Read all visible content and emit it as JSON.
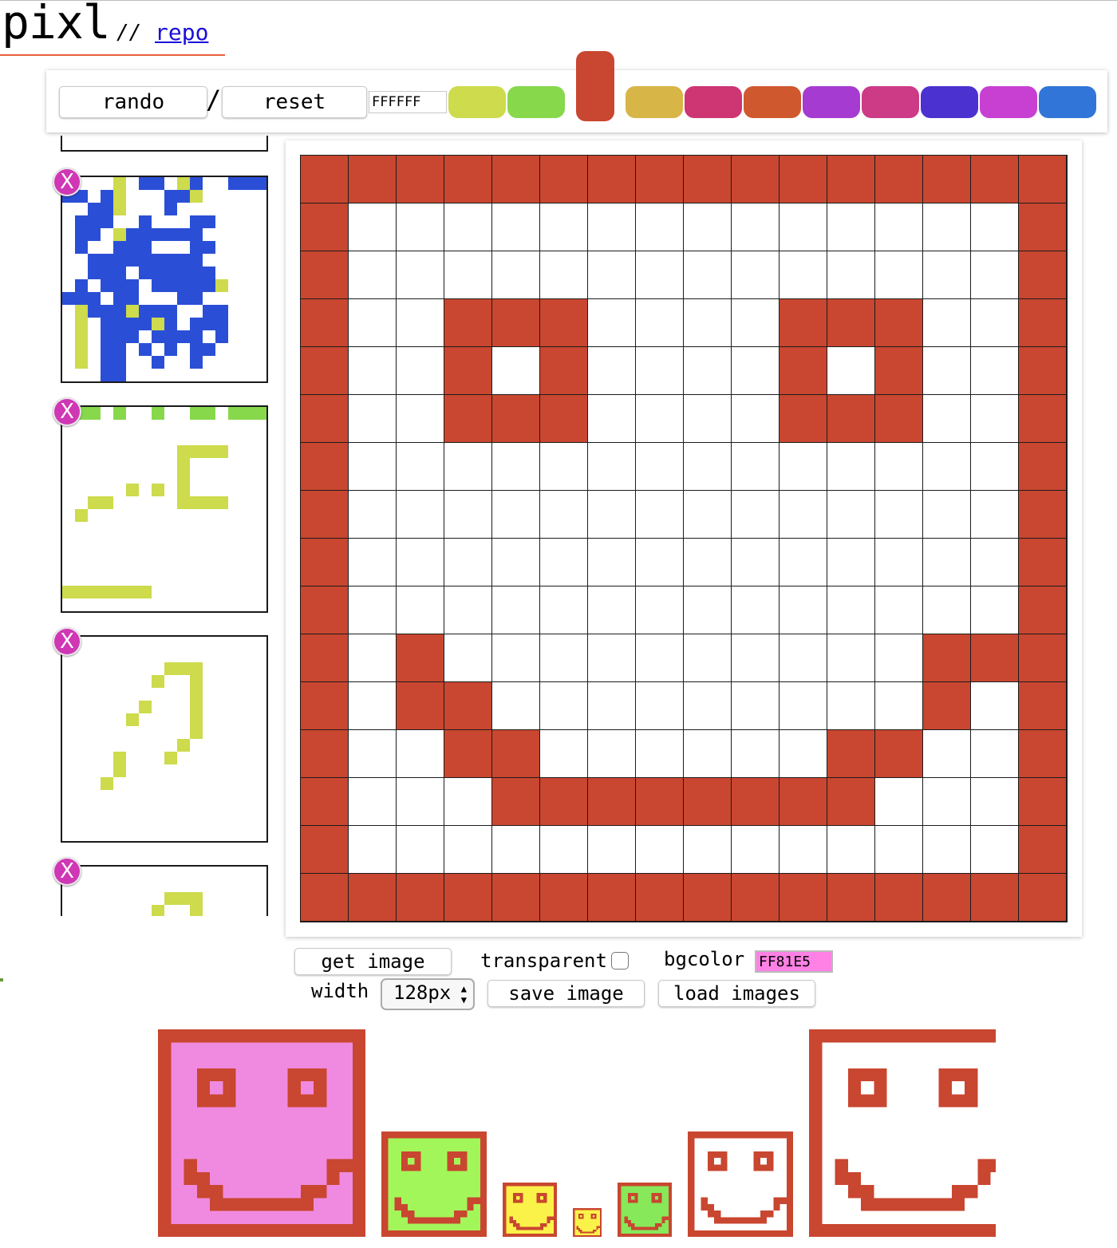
{
  "header": {
    "title": "pixl",
    "separator": "//",
    "repo_link": "repo"
  },
  "toolbar": {
    "rando_label": "rando",
    "slash": "/",
    "reset_label": "reset",
    "hex_value": "FFFFFF",
    "swatches": [
      "#cddb4c",
      "#87d84b",
      "#c94630",
      "#d8b547",
      "#cd3573",
      "#d0582f",
      "#a53bd0",
      "#cd3a86",
      "#4b31cf",
      "#c840d1",
      "#3275d8"
    ],
    "selected_swatch": 2
  },
  "thumbnails": {
    "delete_label": "X",
    "items": [
      {
        "colors": [
          "#2a4fd6",
          "#cddb4c"
        ]
      },
      {
        "colors": [
          "#cddb4c",
          "#87d84b"
        ]
      },
      {
        "colors": [
          "#cddb4c"
        ]
      },
      {
        "colors": [
          "#cddb4c"
        ]
      }
    ]
  },
  "editor": {
    "grid_size": 16,
    "paint_color": "#c94630",
    "background_color": "#ffffff",
    "rows": [
      "1111111111111111",
      "1000000000000001",
      "1000000000000001",
      "1001110000111001",
      "1001010000101001",
      "1001110000111001",
      "1000000000000001",
      "1000000000000001",
      "1000000000000001",
      "1000000000000001",
      "1010000000000111",
      "1011000000000101",
      "1001100000011001",
      "1000111111110001",
      "1000000000000001",
      "1111111111111111"
    ]
  },
  "controls": {
    "get_image_label": "get image",
    "transparent_label": "transparent",
    "transparent_checked": false,
    "bgcolor_label": "bgcolor",
    "bgcolor_value": "FF81E5",
    "width_label": "width",
    "width_value": "128px",
    "save_image_label": "save image",
    "load_images_label": "load images"
  },
  "outputs": [
    {
      "fill": "#f08ae0"
    },
    {
      "fill": "#a3f65a"
    },
    {
      "fill": "#fbf249"
    },
    {
      "fill": "#fbf249"
    },
    {
      "fill": "#87e85a"
    },
    {
      "fill": "#ffffff"
    },
    {
      "fill": "#ffffff"
    }
  ]
}
